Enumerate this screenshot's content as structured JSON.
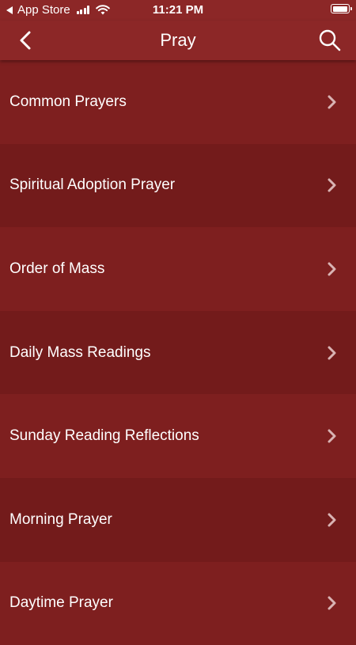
{
  "status_bar": {
    "back_app": "App Store",
    "time": "11:21 PM",
    "battery_level": 0.95
  },
  "nav": {
    "title": "Pray",
    "back_icon": "chevron-left-icon",
    "search_icon": "search-icon"
  },
  "list": {
    "items": [
      {
        "label": "Common Prayers"
      },
      {
        "label": "Spiritual Adoption Prayer"
      },
      {
        "label": "Order of Mass"
      },
      {
        "label": "Daily Mass Readings"
      },
      {
        "label": "Sunday Reading Reflections"
      },
      {
        "label": "Morning Prayer"
      },
      {
        "label": "Daytime Prayer"
      }
    ]
  },
  "colors": {
    "nav_background": "#8c2727",
    "row_odd": "#7e1f1f",
    "row_even": "#731b1b",
    "chevron": "#d9b3b3"
  }
}
